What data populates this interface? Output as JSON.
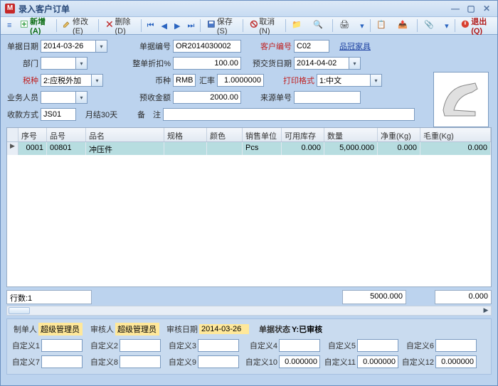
{
  "title": "录入客户订单",
  "toolbar": {
    "add": "新增(A)",
    "edit": "修改(E)",
    "delete": "删除(D)",
    "save": "保存(S)",
    "cancel": "取消(N)",
    "exit": "退出(Q)"
  },
  "form": {
    "order_date_lbl": "单据日期",
    "order_date": "2014-03-26",
    "order_no_lbl": "单据编号",
    "order_no": "OR2014030002",
    "cust_no_lbl": "客户编号",
    "cust_no": "C02",
    "cust_name": "品冠家具",
    "dept_lbl": "部门",
    "dept": "",
    "discount_lbl": "整单折扣%",
    "discount": "100.00",
    "predeliv_lbl": "预交货日期",
    "predeliv": "2014-04-02",
    "tax_lbl": "税种",
    "tax": "2:应税外加",
    "currency_lbl": "币种",
    "currency": "RMB",
    "rate_lbl": "汇率",
    "rate": "1.0000000",
    "printfmt_lbl": "打印格式",
    "printfmt": "1:中文",
    "sales_lbl": "业务人员",
    "sales": "",
    "prepay_lbl": "预收金额",
    "prepay": "2000.00",
    "src_lbl": "来源单号",
    "src": "",
    "paymode_lbl": "收款方式",
    "paymode": "JS01",
    "payterm": "月结30天",
    "remark_lbl": "备　注",
    "remark": ""
  },
  "grid": {
    "headers": {
      "seq": "序号",
      "item_no": "品号",
      "item_name": "品名",
      "spec": "规格",
      "color": "颜色",
      "unit": "销售单位",
      "stock": "可用库存",
      "qty": "数量",
      "net": "净重(Kg)",
      "gross": "毛重(Kg)"
    },
    "row": {
      "seq": "0001",
      "item_no": "00801",
      "item_name": "冲压件",
      "spec": "",
      "color": "",
      "unit": "Pcs",
      "stock": "0.000",
      "qty": "5,000.000",
      "net": "0.000",
      "gross": "0.000"
    },
    "footer": {
      "rows": "行数:1",
      "sum_qty": "5000.000",
      "sum_wt": "0.000"
    }
  },
  "bottom": {
    "maker_lbl": "制单人",
    "maker": "超级管理员",
    "checker_lbl": "审核人",
    "checker": "超级管理员",
    "checkdate_lbl": "审核日期",
    "checkdate": "2014-03-26",
    "status_lbl": "单据状态",
    "status": "Y:已审核",
    "c1l": "自定义1",
    "c1": "",
    "c2l": "自定义2",
    "c2": "",
    "c3l": "自定义3",
    "c3": "",
    "c4l": "自定义4",
    "c4": "",
    "c5l": "自定义5",
    "c5": "",
    "c6l": "自定义6",
    "c6": "",
    "c7l": "自定义7",
    "c7": "",
    "c8l": "自定义8",
    "c8": "",
    "c9l": "自定义9",
    "c9": "",
    "c10l": "自定义10",
    "c10": "0.000000",
    "c11l": "自定义11",
    "c11": "0.000000",
    "c12l": "自定义12",
    "c12": "0.000000"
  }
}
